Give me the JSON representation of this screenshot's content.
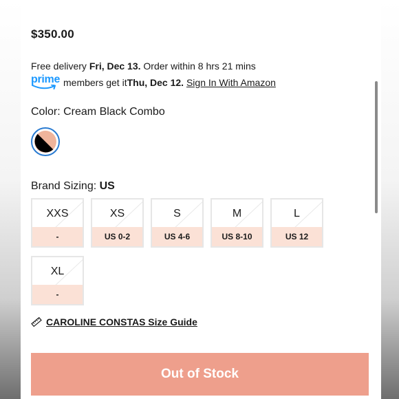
{
  "product": {
    "price": "$350.00"
  },
  "delivery": {
    "prefix": "Free delivery ",
    "date": "Fri, Dec 13.",
    "suffix": " Order within 8 hrs 21 mins"
  },
  "prime": {
    "logo_text": "prime",
    "prefix": "members get it ",
    "date": "Thu, Dec 12.",
    "link": "Sign In With Amazon",
    "brand_color": "#1a98ff"
  },
  "color": {
    "label": "Color: Cream Black Combo",
    "swatch_colors": [
      "#000000",
      "#efb49b"
    ],
    "selected_ring_color": "#2a7bd1"
  },
  "sizing": {
    "label_prefix": "Brand Sizing: ",
    "label_value": "US",
    "sizes": [
      {
        "name": "XXS",
        "us": "-"
      },
      {
        "name": "XS",
        "us": "US 0-2"
      },
      {
        "name": "S",
        "us": "US 4-6"
      },
      {
        "name": "M",
        "us": "US 8-10"
      },
      {
        "name": "L",
        "us": "US 12"
      },
      {
        "name": "XL",
        "us": "-"
      }
    ]
  },
  "size_guide": {
    "icon": "ruler-icon",
    "label": "CAROLINE CONSTAS Size Guide"
  },
  "cta": {
    "label": "Out of Stock",
    "color": "#ee9f8c"
  }
}
